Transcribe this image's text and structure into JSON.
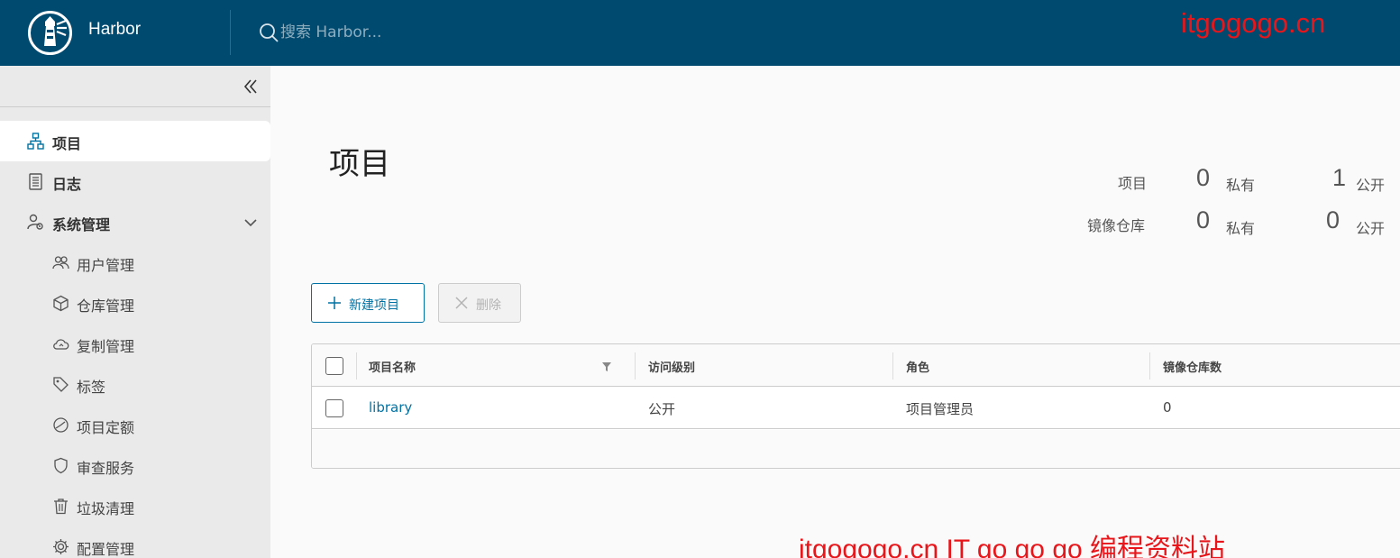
{
  "header": {
    "brand": "Harbor",
    "search_placeholder": "搜索 Harbor...",
    "watermark": "itgogogo.cn"
  },
  "sidebar": {
    "items": [
      {
        "label": "项目",
        "icon": "project-icon",
        "active": true
      },
      {
        "label": "日志",
        "icon": "log-icon"
      },
      {
        "label": "系统管理",
        "icon": "admin-icon",
        "expanded": true
      }
    ],
    "sub_items": [
      {
        "label": "用户管理",
        "icon": "users-icon"
      },
      {
        "label": "仓库管理",
        "icon": "box-icon"
      },
      {
        "label": "复制管理",
        "icon": "cloud-icon"
      },
      {
        "label": "标签",
        "icon": "tag-icon"
      },
      {
        "label": "项目定额",
        "icon": "quota-icon"
      },
      {
        "label": "审查服务",
        "icon": "shield-icon"
      },
      {
        "label": "垃圾清理",
        "icon": "trash-icon"
      },
      {
        "label": "配置管理",
        "icon": "gear-icon"
      }
    ]
  },
  "main": {
    "title": "项目",
    "stats": {
      "projects_label": "项目",
      "repos_label": "镜像仓库",
      "private_label": "私有",
      "public_label": "公开",
      "projects_private": "0",
      "projects_public": "1",
      "repos_private": "0",
      "repos_public": "0"
    },
    "buttons": {
      "new_project": "新建项目",
      "delete": "删除"
    },
    "table": {
      "columns": [
        "项目名称",
        "访问级别",
        "角色",
        "镜像仓库数"
      ],
      "rows": [
        {
          "name": "library",
          "access": "公开",
          "role": "项目管理员",
          "repo_count": "0"
        }
      ]
    }
  },
  "footer_watermark": "itgogogo.cn IT go go go 编程资料站",
  "colors": {
    "header_bg": "#004a70",
    "accent": "#0072a3",
    "watermark": "#e8161a",
    "sidebar_bg": "#eaeaea"
  }
}
